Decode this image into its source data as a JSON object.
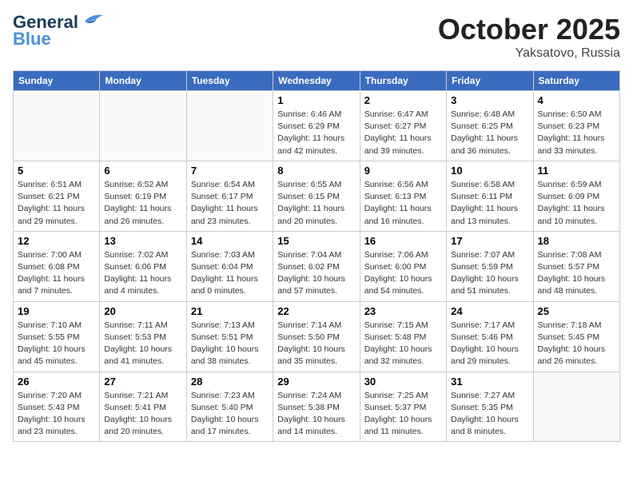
{
  "header": {
    "logo_line1": "General",
    "logo_line2": "Blue",
    "month": "October 2025",
    "location": "Yaksatovo, Russia"
  },
  "weekdays": [
    "Sunday",
    "Monday",
    "Tuesday",
    "Wednesday",
    "Thursday",
    "Friday",
    "Saturday"
  ],
  "weeks": [
    [
      {
        "day": "",
        "info": ""
      },
      {
        "day": "",
        "info": ""
      },
      {
        "day": "",
        "info": ""
      },
      {
        "day": "1",
        "info": "Sunrise: 6:46 AM\nSunset: 6:29 PM\nDaylight: 11 hours\nand 42 minutes."
      },
      {
        "day": "2",
        "info": "Sunrise: 6:47 AM\nSunset: 6:27 PM\nDaylight: 11 hours\nand 39 minutes."
      },
      {
        "day": "3",
        "info": "Sunrise: 6:48 AM\nSunset: 6:25 PM\nDaylight: 11 hours\nand 36 minutes."
      },
      {
        "day": "4",
        "info": "Sunrise: 6:50 AM\nSunset: 6:23 PM\nDaylight: 11 hours\nand 33 minutes."
      }
    ],
    [
      {
        "day": "5",
        "info": "Sunrise: 6:51 AM\nSunset: 6:21 PM\nDaylight: 11 hours\nand 29 minutes."
      },
      {
        "day": "6",
        "info": "Sunrise: 6:52 AM\nSunset: 6:19 PM\nDaylight: 11 hours\nand 26 minutes."
      },
      {
        "day": "7",
        "info": "Sunrise: 6:54 AM\nSunset: 6:17 PM\nDaylight: 11 hours\nand 23 minutes."
      },
      {
        "day": "8",
        "info": "Sunrise: 6:55 AM\nSunset: 6:15 PM\nDaylight: 11 hours\nand 20 minutes."
      },
      {
        "day": "9",
        "info": "Sunrise: 6:56 AM\nSunset: 6:13 PM\nDaylight: 11 hours\nand 16 minutes."
      },
      {
        "day": "10",
        "info": "Sunrise: 6:58 AM\nSunset: 6:11 PM\nDaylight: 11 hours\nand 13 minutes."
      },
      {
        "day": "11",
        "info": "Sunrise: 6:59 AM\nSunset: 6:09 PM\nDaylight: 11 hours\nand 10 minutes."
      }
    ],
    [
      {
        "day": "12",
        "info": "Sunrise: 7:00 AM\nSunset: 6:08 PM\nDaylight: 11 hours\nand 7 minutes."
      },
      {
        "day": "13",
        "info": "Sunrise: 7:02 AM\nSunset: 6:06 PM\nDaylight: 11 hours\nand 4 minutes."
      },
      {
        "day": "14",
        "info": "Sunrise: 7:03 AM\nSunset: 6:04 PM\nDaylight: 11 hours\nand 0 minutes."
      },
      {
        "day": "15",
        "info": "Sunrise: 7:04 AM\nSunset: 6:02 PM\nDaylight: 10 hours\nand 57 minutes."
      },
      {
        "day": "16",
        "info": "Sunrise: 7:06 AM\nSunset: 6:00 PM\nDaylight: 10 hours\nand 54 minutes."
      },
      {
        "day": "17",
        "info": "Sunrise: 7:07 AM\nSunset: 5:59 PM\nDaylight: 10 hours\nand 51 minutes."
      },
      {
        "day": "18",
        "info": "Sunrise: 7:08 AM\nSunset: 5:57 PM\nDaylight: 10 hours\nand 48 minutes."
      }
    ],
    [
      {
        "day": "19",
        "info": "Sunrise: 7:10 AM\nSunset: 5:55 PM\nDaylight: 10 hours\nand 45 minutes."
      },
      {
        "day": "20",
        "info": "Sunrise: 7:11 AM\nSunset: 5:53 PM\nDaylight: 10 hours\nand 41 minutes."
      },
      {
        "day": "21",
        "info": "Sunrise: 7:13 AM\nSunset: 5:51 PM\nDaylight: 10 hours\nand 38 minutes."
      },
      {
        "day": "22",
        "info": "Sunrise: 7:14 AM\nSunset: 5:50 PM\nDaylight: 10 hours\nand 35 minutes."
      },
      {
        "day": "23",
        "info": "Sunrise: 7:15 AM\nSunset: 5:48 PM\nDaylight: 10 hours\nand 32 minutes."
      },
      {
        "day": "24",
        "info": "Sunrise: 7:17 AM\nSunset: 5:46 PM\nDaylight: 10 hours\nand 29 minutes."
      },
      {
        "day": "25",
        "info": "Sunrise: 7:18 AM\nSunset: 5:45 PM\nDaylight: 10 hours\nand 26 minutes."
      }
    ],
    [
      {
        "day": "26",
        "info": "Sunrise: 7:20 AM\nSunset: 5:43 PM\nDaylight: 10 hours\nand 23 minutes."
      },
      {
        "day": "27",
        "info": "Sunrise: 7:21 AM\nSunset: 5:41 PM\nDaylight: 10 hours\nand 20 minutes."
      },
      {
        "day": "28",
        "info": "Sunrise: 7:23 AM\nSunset: 5:40 PM\nDaylight: 10 hours\nand 17 minutes."
      },
      {
        "day": "29",
        "info": "Sunrise: 7:24 AM\nSunset: 5:38 PM\nDaylight: 10 hours\nand 14 minutes."
      },
      {
        "day": "30",
        "info": "Sunrise: 7:25 AM\nSunset: 5:37 PM\nDaylight: 10 hours\nand 11 minutes."
      },
      {
        "day": "31",
        "info": "Sunrise: 7:27 AM\nSunset: 5:35 PM\nDaylight: 10 hours\nand 8 minutes."
      },
      {
        "day": "",
        "info": ""
      }
    ]
  ]
}
